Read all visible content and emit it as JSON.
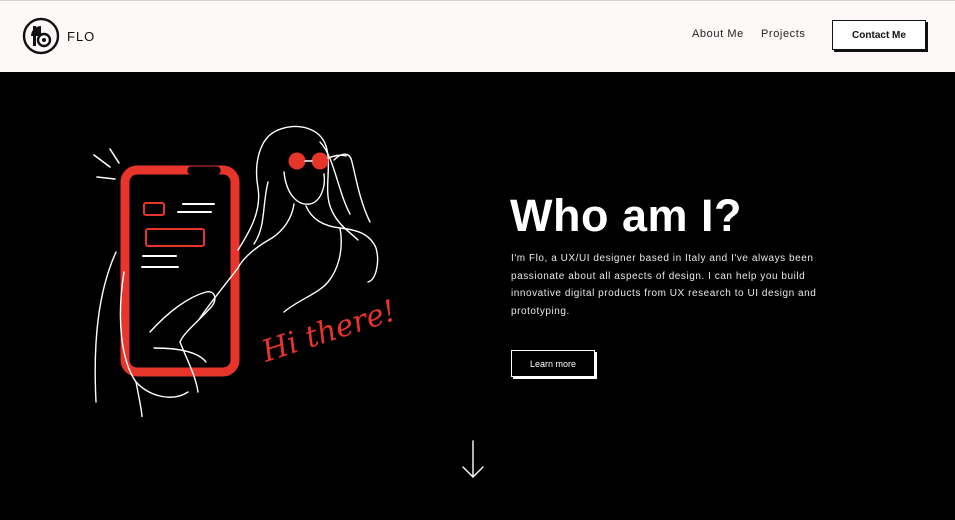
{
  "brand": {
    "name": "FLO",
    "logo_icon": "flo-circle-logo-icon"
  },
  "nav": {
    "items": [
      {
        "label": "About Me"
      },
      {
        "label": "Projects"
      }
    ],
    "contact_label": "Contact Me"
  },
  "hero": {
    "title": "Who am I?",
    "description": "I'm Flo, a UX/UI designer based in Italy and I've always been passionate about all aspects of design. I can help you build innovative digital products from UX research to UI design and prototyping.",
    "button_label": "Learn more",
    "illustration_text": "Hi there!",
    "scroll_icon": "arrow-down-icon"
  },
  "colors": {
    "background": "#000000",
    "header_bg": "#fdf9f8",
    "accent": "#e8352b",
    "text_light": "#ffffff"
  }
}
